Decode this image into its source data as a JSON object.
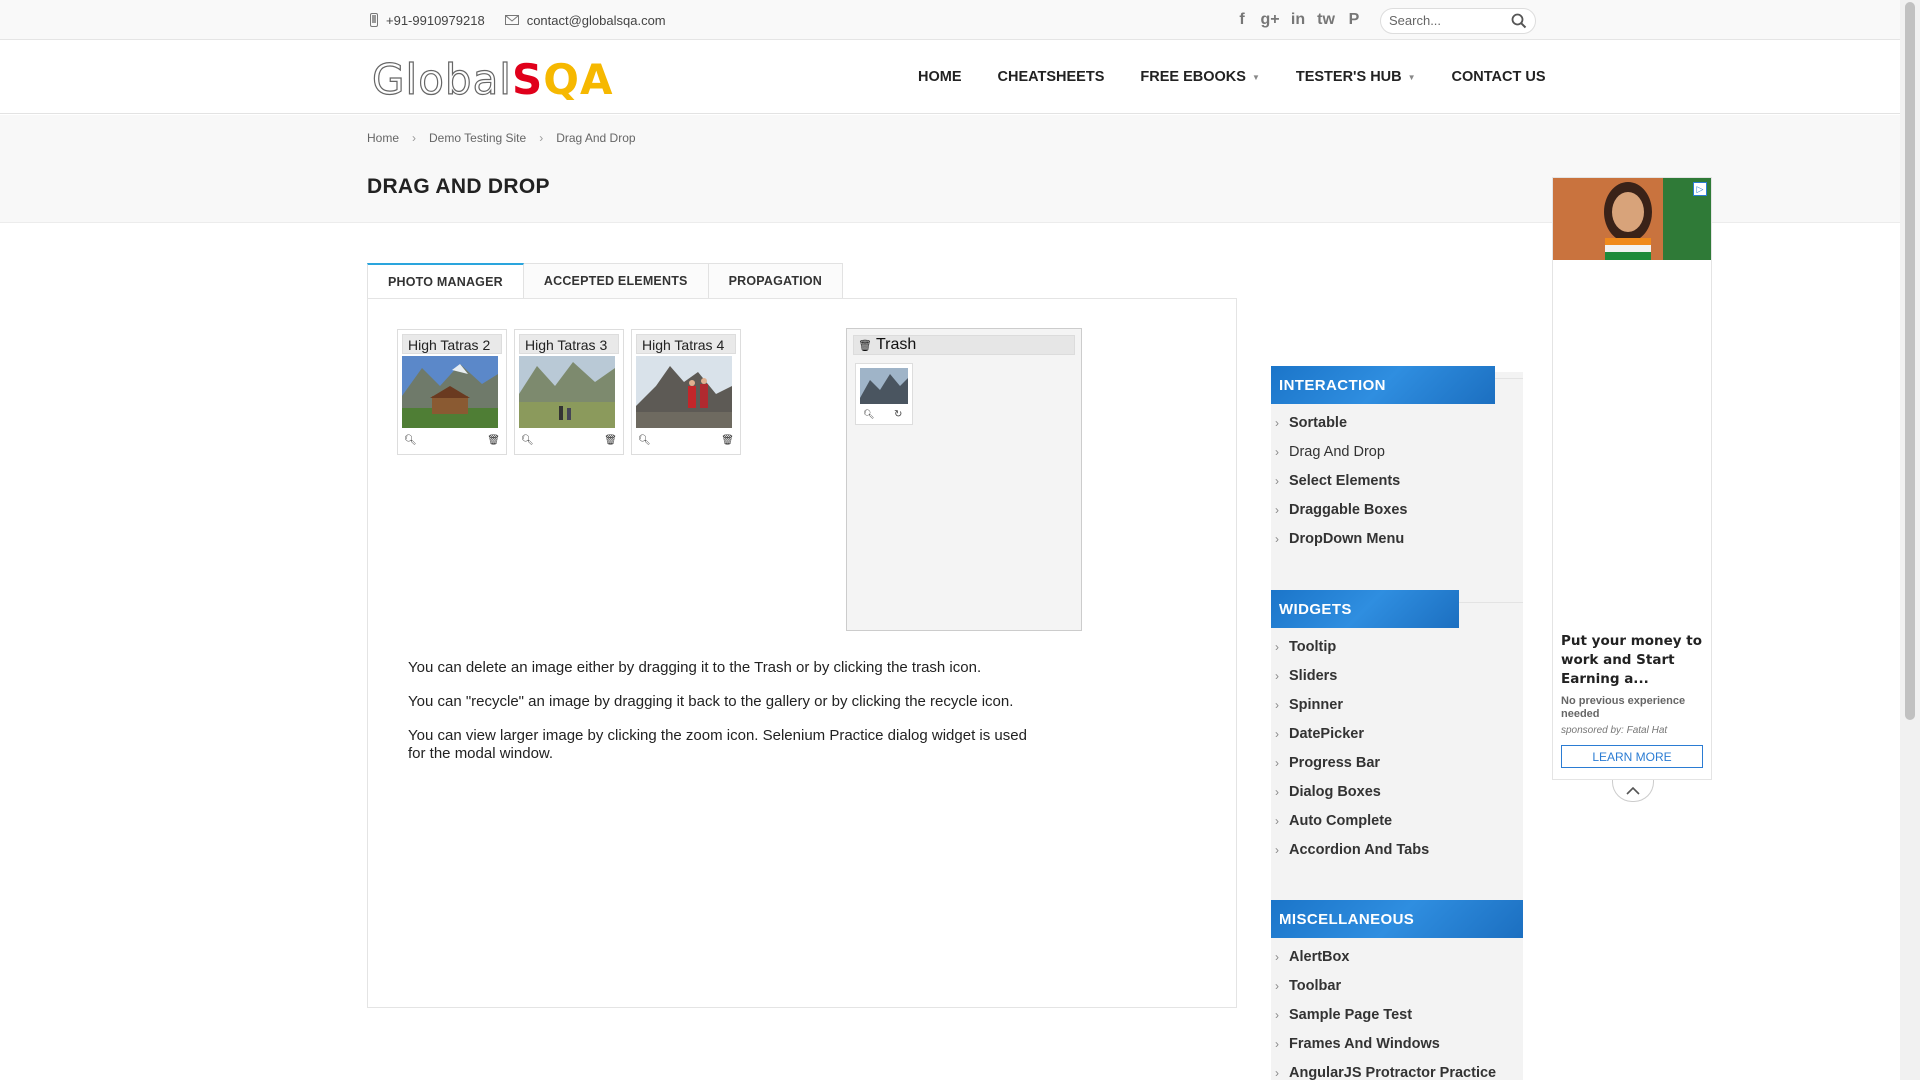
{
  "topbar": {
    "phone": "+91-9910979218",
    "email": "contact@globalsqa.com",
    "social": [
      "f",
      "g+",
      "in",
      "tw",
      "P"
    ],
    "search_placeholder": "Search..."
  },
  "logo": {
    "part1": "Global",
    "part2": "S",
    "part3": "QA"
  },
  "nav": {
    "home": "HOME",
    "cheatsheets": "CHEATSHEETS",
    "ebooks": "FREE EBOOKS",
    "hub": "TESTER'S HUB",
    "contact": "CONTACT US"
  },
  "breadcrumb": {
    "home": "Home",
    "demo": "Demo Testing Site",
    "current": "Drag And Drop"
  },
  "page_title": "DRAG AND DROP",
  "tabs": [
    "PHOTO MANAGER",
    "ACCEPTED ELEMENTS",
    "PROPAGATION"
  ],
  "gallery": [
    "High Tatras 2",
    "High Tatras 3",
    "High Tatras 4"
  ],
  "trash_title": "Trash",
  "description": [
    "You can delete an image either by dragging it to the Trash or by clicking the trash icon.",
    "You can \"recycle\" an image by dragging it back to the gallery or by clicking the recycle icon.",
    "You can view larger image by clicking the zoom icon. Selenium Practice dialog widget is used for the modal window."
  ],
  "sidebar": {
    "interaction": {
      "title": "INTERACTION",
      "items": [
        "Sortable",
        "Drag And Drop",
        "Select Elements",
        "Draggable Boxes",
        "DropDown Menu"
      ]
    },
    "widgets": {
      "title": "WIDGETS",
      "items": [
        "Tooltip",
        "Sliders",
        "Spinner",
        "DatePicker",
        "Progress Bar",
        "Dialog Boxes",
        "Auto Complete",
        "Accordion And Tabs"
      ]
    },
    "misc": {
      "title": "MISCELLANEOUS",
      "items": [
        "AlertBox",
        "Toolbar",
        "Sample Page Test",
        "Frames And Windows",
        "AngularJS Protractor Practice"
      ]
    }
  },
  "ad": {
    "title": "Put your money to work and Start Earning a...",
    "subtitle": "No previous experience needed",
    "sponsor": "sponsored by: Fatal Hat",
    "button": "LEARN MORE"
  },
  "colors": {
    "accent": "#2aa5dd",
    "sidebar_head": "#1b75c9",
    "logo_red": "#e0001b",
    "logo_yellow": "#f6b800"
  }
}
